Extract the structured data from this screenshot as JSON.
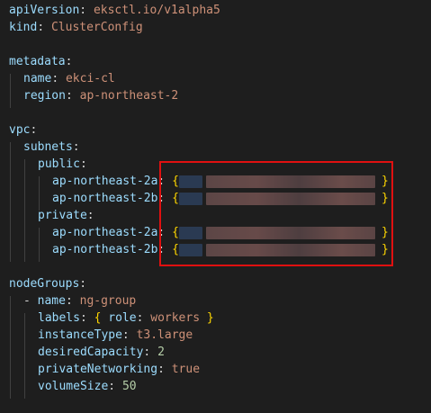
{
  "code": {
    "line1": {
      "key": "apiVersion",
      "value": "eksctl.io/v1alpha5"
    },
    "line2": {
      "key": "kind",
      "value": "ClusterConfig"
    },
    "line4": {
      "key": "metadata"
    },
    "line5": {
      "key": "name",
      "value": "ekci-cl"
    },
    "line6": {
      "key": "region",
      "value": "ap-northeast-2"
    },
    "line8": {
      "key": "vpc"
    },
    "line9": {
      "key": "subnets"
    },
    "line10": {
      "key": "public"
    },
    "line11": {
      "key": "ap-northeast-2a"
    },
    "line12": {
      "key": "ap-northeast-2b"
    },
    "line13": {
      "key": "private"
    },
    "line14": {
      "key": "ap-northeast-2a"
    },
    "line15": {
      "key": "ap-northeast-2b"
    },
    "line17": {
      "key": "nodeGroups"
    },
    "line18": {
      "key": "name",
      "value": "ng-group"
    },
    "line19": {
      "key": "labels",
      "inner_key": "role",
      "inner_value": "workers"
    },
    "line20": {
      "key": "instanceType",
      "value": "t3.large"
    },
    "line21": {
      "key": "desiredCapacity",
      "value": "2"
    },
    "line22": {
      "key": "privateNetworking",
      "value": "true"
    },
    "line23": {
      "key": "volumeSize",
      "value": "50"
    }
  },
  "colors": {
    "background": "#1e1e1e",
    "key": "#9cdcfe",
    "string": "#ce9178",
    "number": "#b5cea8",
    "bracket": "#ffd700",
    "highlight_box": "#e01010"
  }
}
